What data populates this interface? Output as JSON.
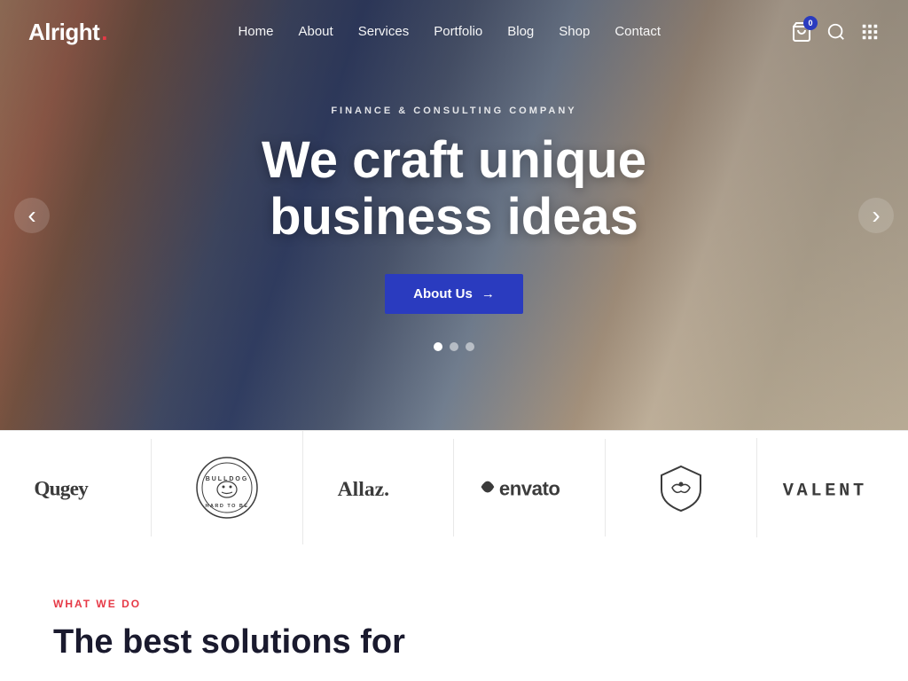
{
  "brand": {
    "name": "Alright",
    "dot": "."
  },
  "navbar": {
    "links": [
      {
        "label": "Home",
        "href": "#"
      },
      {
        "label": "About",
        "href": "#"
      },
      {
        "label": "Services",
        "href": "#"
      },
      {
        "label": "Portfolio",
        "href": "#"
      },
      {
        "label": "Blog",
        "href": "#"
      },
      {
        "label": "Shop",
        "href": "#"
      },
      {
        "label": "Contact",
        "href": "#"
      }
    ],
    "cart_count": "0",
    "icons": {
      "cart": "🛒",
      "search": "🔍",
      "grid": "⋮⋮⋮"
    }
  },
  "hero": {
    "subtitle": "Finance & Consulting Company",
    "title_line1": "We craft unique",
    "title_line2": "business ideas",
    "cta_label": "About Us",
    "cta_arrow": "→",
    "dots": [
      true,
      false,
      false
    ],
    "arrow_left": "‹",
    "arrow_right": "›"
  },
  "logos": [
    {
      "name": "qugey",
      "display": "Qugey",
      "style": "serif-bold"
    },
    {
      "name": "bulldog",
      "display": "BULLDOG",
      "style": "badge"
    },
    {
      "name": "allaz",
      "display": "Allaz.",
      "style": "modern"
    },
    {
      "name": "envato",
      "display": "envato",
      "style": "bold-leaf"
    },
    {
      "name": "valent-shield",
      "display": "shield",
      "style": "icon"
    },
    {
      "name": "valent",
      "display": "VALENT",
      "style": "spaced"
    }
  ],
  "what_we_do": {
    "section_label": "WHAT WE DO",
    "title": "The best solutions for"
  }
}
